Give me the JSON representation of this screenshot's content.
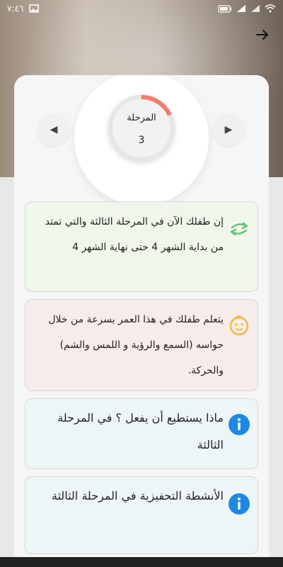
{
  "status": {
    "time": "٧:٤٦"
  },
  "stage": {
    "label": "المرحلة",
    "number": "3",
    "progress": 0.18,
    "progress_color": "#f47b6b"
  },
  "cards": [
    {
      "text": "إن طفلك الآن في المرحلة الثالثة والتي تمتد من بداية الشهر 4 حتى نهاية الشهر 4",
      "icon": "refresh-arrows-icon",
      "icon_color": "#6fc17a"
    },
    {
      "text": "يتعلم طفلك في هذا العمر بسرعة من خلال حواسه (السمع والرؤية و اللمس والشم) والحركة.",
      "icon": "baby-face-icon",
      "icon_color": "#f2b83a"
    },
    {
      "text": "ماذا يستطيع أن يفعل ؟ في المرحلة الثالثة",
      "icon": "info-icon",
      "icon_color": "#1e88e5"
    },
    {
      "text": "الأنشطة التحفيزية في المرحلة الثالثة",
      "icon": "info-icon",
      "icon_color": "#1e88e5"
    }
  ]
}
